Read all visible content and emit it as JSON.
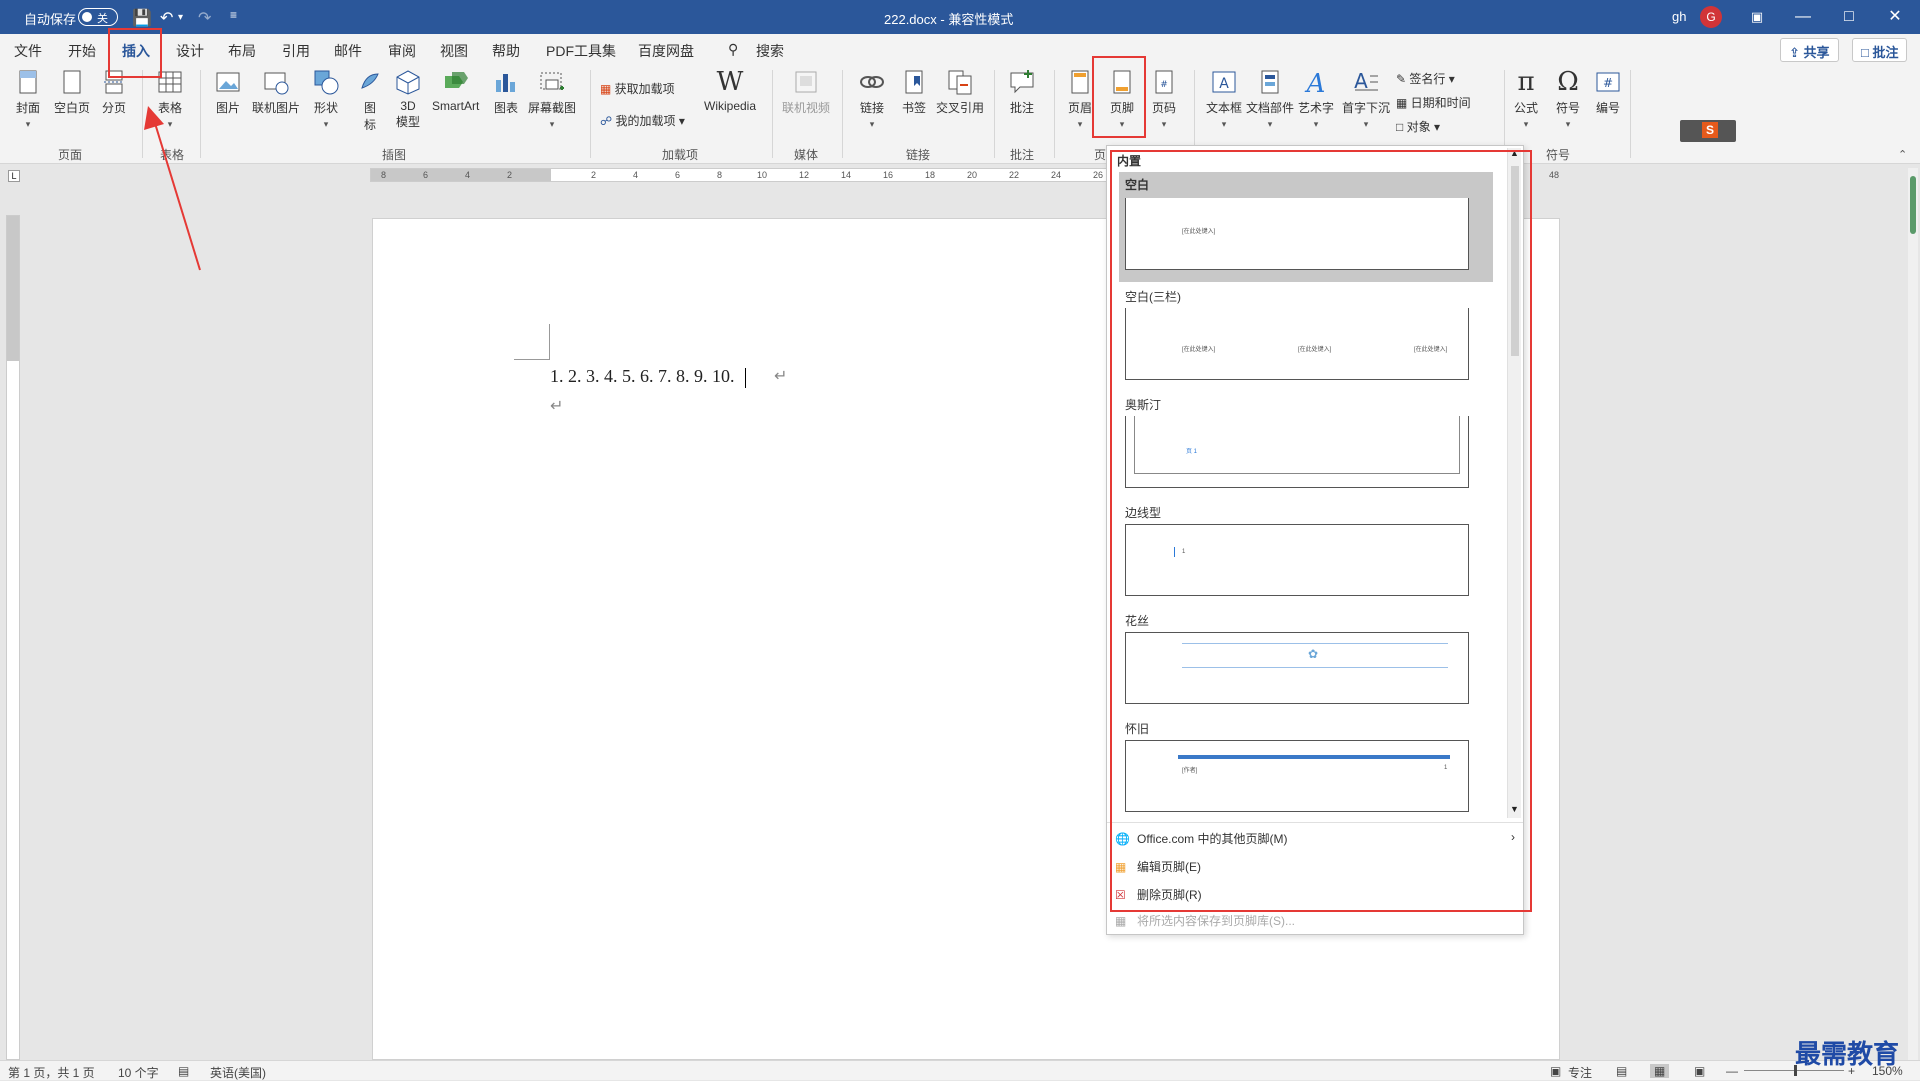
{
  "titlebar": {
    "autosave_label": "自动保存",
    "autosave_state": "关",
    "doc_title": "222.docx - 兼容性模式",
    "user": "gh",
    "avatar_letter": "G"
  },
  "tabs": [
    "文件",
    "开始",
    "插入",
    "设计",
    "布局",
    "引用",
    "邮件",
    "审阅",
    "视图",
    "帮助",
    "PDF工具集",
    "百度网盘"
  ],
  "active_tab": "插入",
  "search_label": "搜索",
  "share_label": "共享",
  "comment_label": "批注",
  "ribbon": {
    "pages": {
      "cover": "封面",
      "blank": "空白页",
      "break": "分页",
      "group": "页面"
    },
    "table": {
      "table": "表格",
      "group": "表格"
    },
    "illustrations": {
      "picture": "图片",
      "online_picture": "联机图片",
      "shapes": "形状",
      "icons_1": "图",
      "icons_2": "标",
      "model_1": "3D",
      "model_2": "模型",
      "smartart": "SmartArt",
      "chart": "图表",
      "screenshot": "屏幕截图",
      "group": "插图"
    },
    "addins": {
      "get": "获取加载项",
      "my": "我的加载项",
      "wiki": "Wikipedia",
      "group": "加载项"
    },
    "media": {
      "video": "联机视频",
      "group": "媒体"
    },
    "links": {
      "link": "链接",
      "bookmark": "书签",
      "xref": "交叉引用",
      "group": "链接"
    },
    "comments": {
      "comment": "批注",
      "group": "批注"
    },
    "headerfooter": {
      "header": "页眉",
      "footer": "页脚",
      "pagenum": "页码",
      "group": "页"
    },
    "text": {
      "textbox": "文本框",
      "parts": "文档部件",
      "wordart": "艺术字",
      "dropcap": "首字下沉",
      "signature": "签名行",
      "datetime": "日期和时间",
      "object": "对象"
    },
    "symbols": {
      "equation": "公式",
      "symbol": "符号",
      "number": "编号",
      "group": "符号"
    }
  },
  "ruler_ticks": [
    "8",
    "6",
    "4",
    "2",
    "2",
    "4",
    "6",
    "8",
    "10",
    "12",
    "14",
    "16",
    "18",
    "20",
    "22",
    "24",
    "26",
    "48"
  ],
  "document": {
    "line1": "1. 2. 3. 4. 5. 6. 7. 8. 9. 10."
  },
  "footer_dropdown": {
    "section": "内置",
    "items": [
      {
        "name": "空白",
        "sample": "[在此处键入]"
      },
      {
        "name": "空白(三栏)",
        "sample": "[在此处键入]"
      },
      {
        "name": "奥斯汀",
        "sample": "页 1"
      },
      {
        "name": "边线型",
        "sample": "1"
      },
      {
        "name": "花丝",
        "sample": ""
      },
      {
        "name": "怀旧",
        "sample": "[作者]"
      }
    ],
    "menu": {
      "more": "Office.com 中的其他页脚(M)",
      "edit": "编辑页脚(E)",
      "remove": "删除页脚(R)",
      "save": "将所选内容保存到页脚库(S)..."
    }
  },
  "statusbar": {
    "page": "第 1 页，共 1 页",
    "words": "10 个字",
    "lang": "英语(美国)",
    "focus": "专注",
    "zoom": "150%"
  },
  "watermark": "最需教育",
  "colors": {
    "accent": "#2b579a",
    "highlight": "#e53935"
  }
}
